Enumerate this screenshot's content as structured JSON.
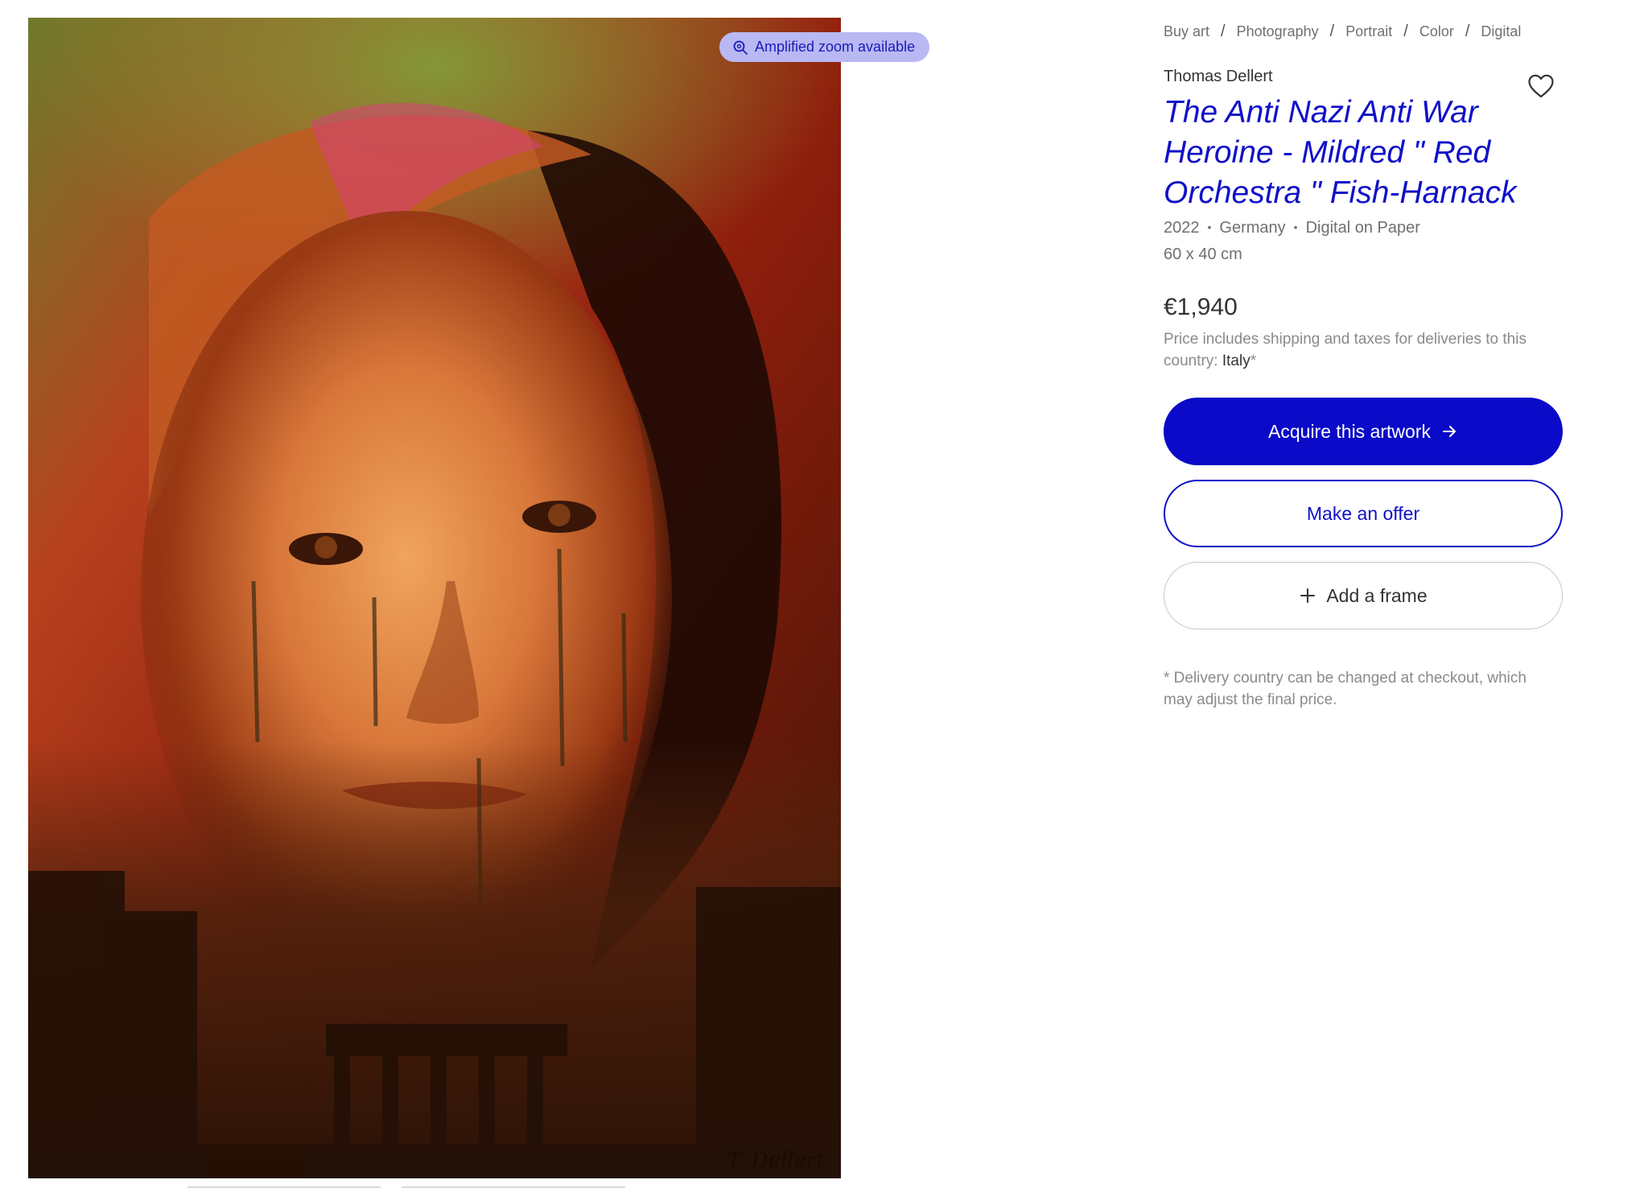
{
  "image": {
    "description_icon": "portrait-artwork",
    "zoom_badge_label": "Amplified zoom available",
    "signature": "T. Dellert"
  },
  "breadcrumb": [
    "Buy art",
    "Photography",
    "Portrait",
    "Color",
    "Digital"
  ],
  "artist": "Thomas Dellert",
  "title": "The Anti Nazi Anti War Heroine - Mildred \" Red Orchestra \" Fish-Harnack",
  "meta": {
    "year": "2022",
    "country": "Germany",
    "medium": "Digital on Paper",
    "dimensions": "60 x 40 cm"
  },
  "price": {
    "amount": "€1,940",
    "note_prefix": "Price includes shipping and taxes for deliveries to this country: ",
    "country": "Italy",
    "asterisk": "*"
  },
  "buttons": {
    "acquire": "Acquire this artwork",
    "offer": "Make an offer",
    "frame": "Add a frame"
  },
  "delivery_note": "* Delivery country can be changed at checkout, which may adjust the final price.",
  "colors": {
    "brand_blue": "#0a0ac8",
    "title_blue": "#1010c9",
    "badge_bg": "#b9b8f3"
  }
}
